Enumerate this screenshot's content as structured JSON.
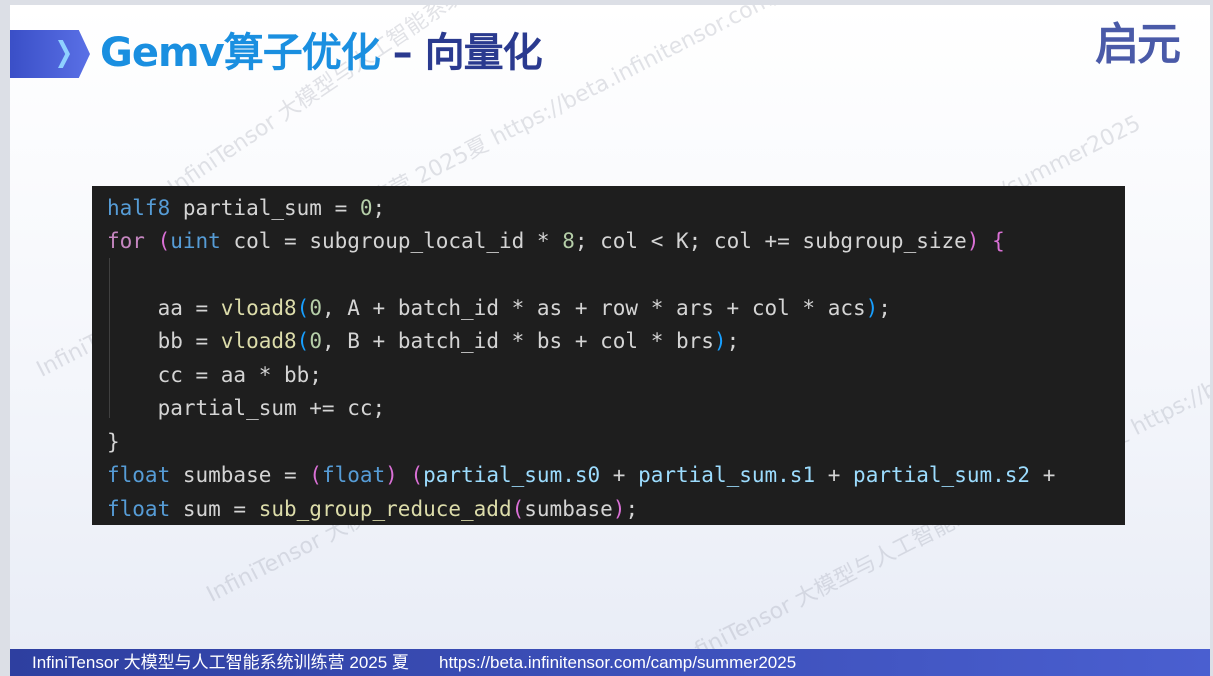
{
  "slide": {
    "title_part1": "Gemv算子优化",
    "title_part2": " – 向量化",
    "logo_text": "启元",
    "watermarks": [
      "InfiniTensor 大模型与人工智能系统训练营 2025夏 https://beta.infinitensor.com/camp/summer2025",
      "InfiniTensor 大模型与人工智能系统训练营 2025夏 https://beta.infinitensor.com/camp/summer2025",
      "InfiniTensor 大模型与人工智能系统训练营 2025夏 https://beta.infinitensor.com/camp/summer2025",
      "InfiniTensor 大模型与人工智能系统训练营 2025夏 https://beta.infinitensor.com/camp/summer2025"
    ],
    "footer_text": "InfiniTensor 大模型与人工智能系统训练营 2025 夏",
    "footer_url": "https://beta.infinitensor.com/camp/summer2025"
  },
  "colors": {
    "title_blue": "#1a8fe0",
    "title_dark": "#2a3a8f",
    "footer_bg": "#3a4fc0",
    "code_bg": "#1e1e1e"
  },
  "code": {
    "l1": {
      "a": "half8",
      "b": " partial_sum = ",
      "c": "0",
      "d": ";"
    },
    "l2": {
      "a": "for",
      "b": " ",
      "c": "(",
      "d": "uint",
      "e": " col = subgroup_local_id * ",
      "f": "8",
      "g": "; col < K; col += subgroup_size",
      "h": ")",
      "i": " ",
      "j": "{"
    },
    "l3": {
      "a": "    aa = ",
      "b": "vload8",
      "c": "(",
      "d": "0",
      "e": ", A + batch_id * as + row * ars + col * acs",
      "f": ")",
      "g": ";"
    },
    "l4": {
      "a": "    bb = ",
      "b": "vload8",
      "c": "(",
      "d": "0",
      "e": ", B + batch_id * bs + col * brs",
      "f": ")",
      "g": ";"
    },
    "l5": "    cc = aa * bb;",
    "l6": "    partial_sum += cc;",
    "l7": "}",
    "l8": {
      "a": "float",
      "b": " sumbase = ",
      "c": "(",
      "d": "float",
      "e": ")",
      "f": " ",
      "g": "(",
      "h": "partial_sum.s0",
      "i": " + ",
      "j": "partial_sum.s1",
      "k": " + ",
      "l": "partial_sum.s2",
      "m": " +"
    },
    "l9": {
      "a": "float",
      "b": " sum = ",
      "c": "sub_group_reduce_add",
      "d": "(",
      "e": "sumbase",
      "f": ")",
      "g": ";"
    }
  }
}
